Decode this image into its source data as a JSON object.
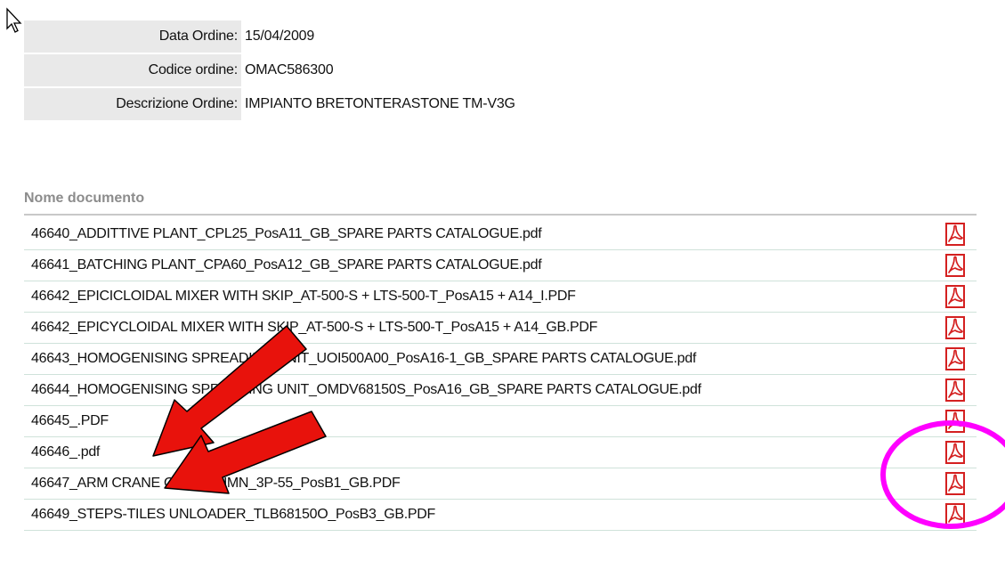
{
  "order": {
    "date_label": "Data Ordine:",
    "date_value": "15/04/2009",
    "code_label": "Codice ordine:",
    "code_value": "OMAC586300",
    "desc_label": "Descrizione Ordine:",
    "desc_value": "IMPIANTO BRETONTERASTONE TM-V3G"
  },
  "documents": {
    "column_header": "Nome documento",
    "icon": "pdf-icon",
    "rows": [
      {
        "name": "46640_ADDITTIVE PLANT_CPL25_PosA11_GB_SPARE PARTS CATALOGUE.pdf"
      },
      {
        "name": "46641_BATCHING PLANT_CPA60_PosA12_GB_SPARE PARTS CATALOGUE.pdf"
      },
      {
        "name": "46642_EPICICLOIDAL MIXER WITH SKIP_AT-500-S + LTS-500-T_PosA15 + A14_I.PDF"
      },
      {
        "name": "46642_EPICYCLOIDAL MIXER WITH SKIP_AT-500-S + LTS-500-T_PosA15 + A14_GB.PDF"
      },
      {
        "name": "46643_HOMOGENISING SPREADING UNIT_UOI500A00_PosA16-1_GB_SPARE PARTS CATALOGUE.pdf"
      },
      {
        "name": "46644_HOMOGENISING SPREADING UNIT_OMDV68150S_PosA16_GB_SPARE PARTS CATALOGUE.pdf"
      },
      {
        "name": "46645_.PDF"
      },
      {
        "name": "46646_.pdf"
      },
      {
        "name": "46647_ARM CRANE ON COLUMN_3P-55_PosB1_GB.PDF"
      },
      {
        "name": "46649_STEPS-TILES UNLOADER_TLB68150O_PosB3_GB.PDF"
      }
    ]
  },
  "colors": {
    "pdf_red": "#d42020",
    "arrow_red": "#e8120c",
    "circle_magenta": "#ff00ff",
    "row_border": "#cfe2da",
    "label_bg": "#e9e9e9"
  }
}
